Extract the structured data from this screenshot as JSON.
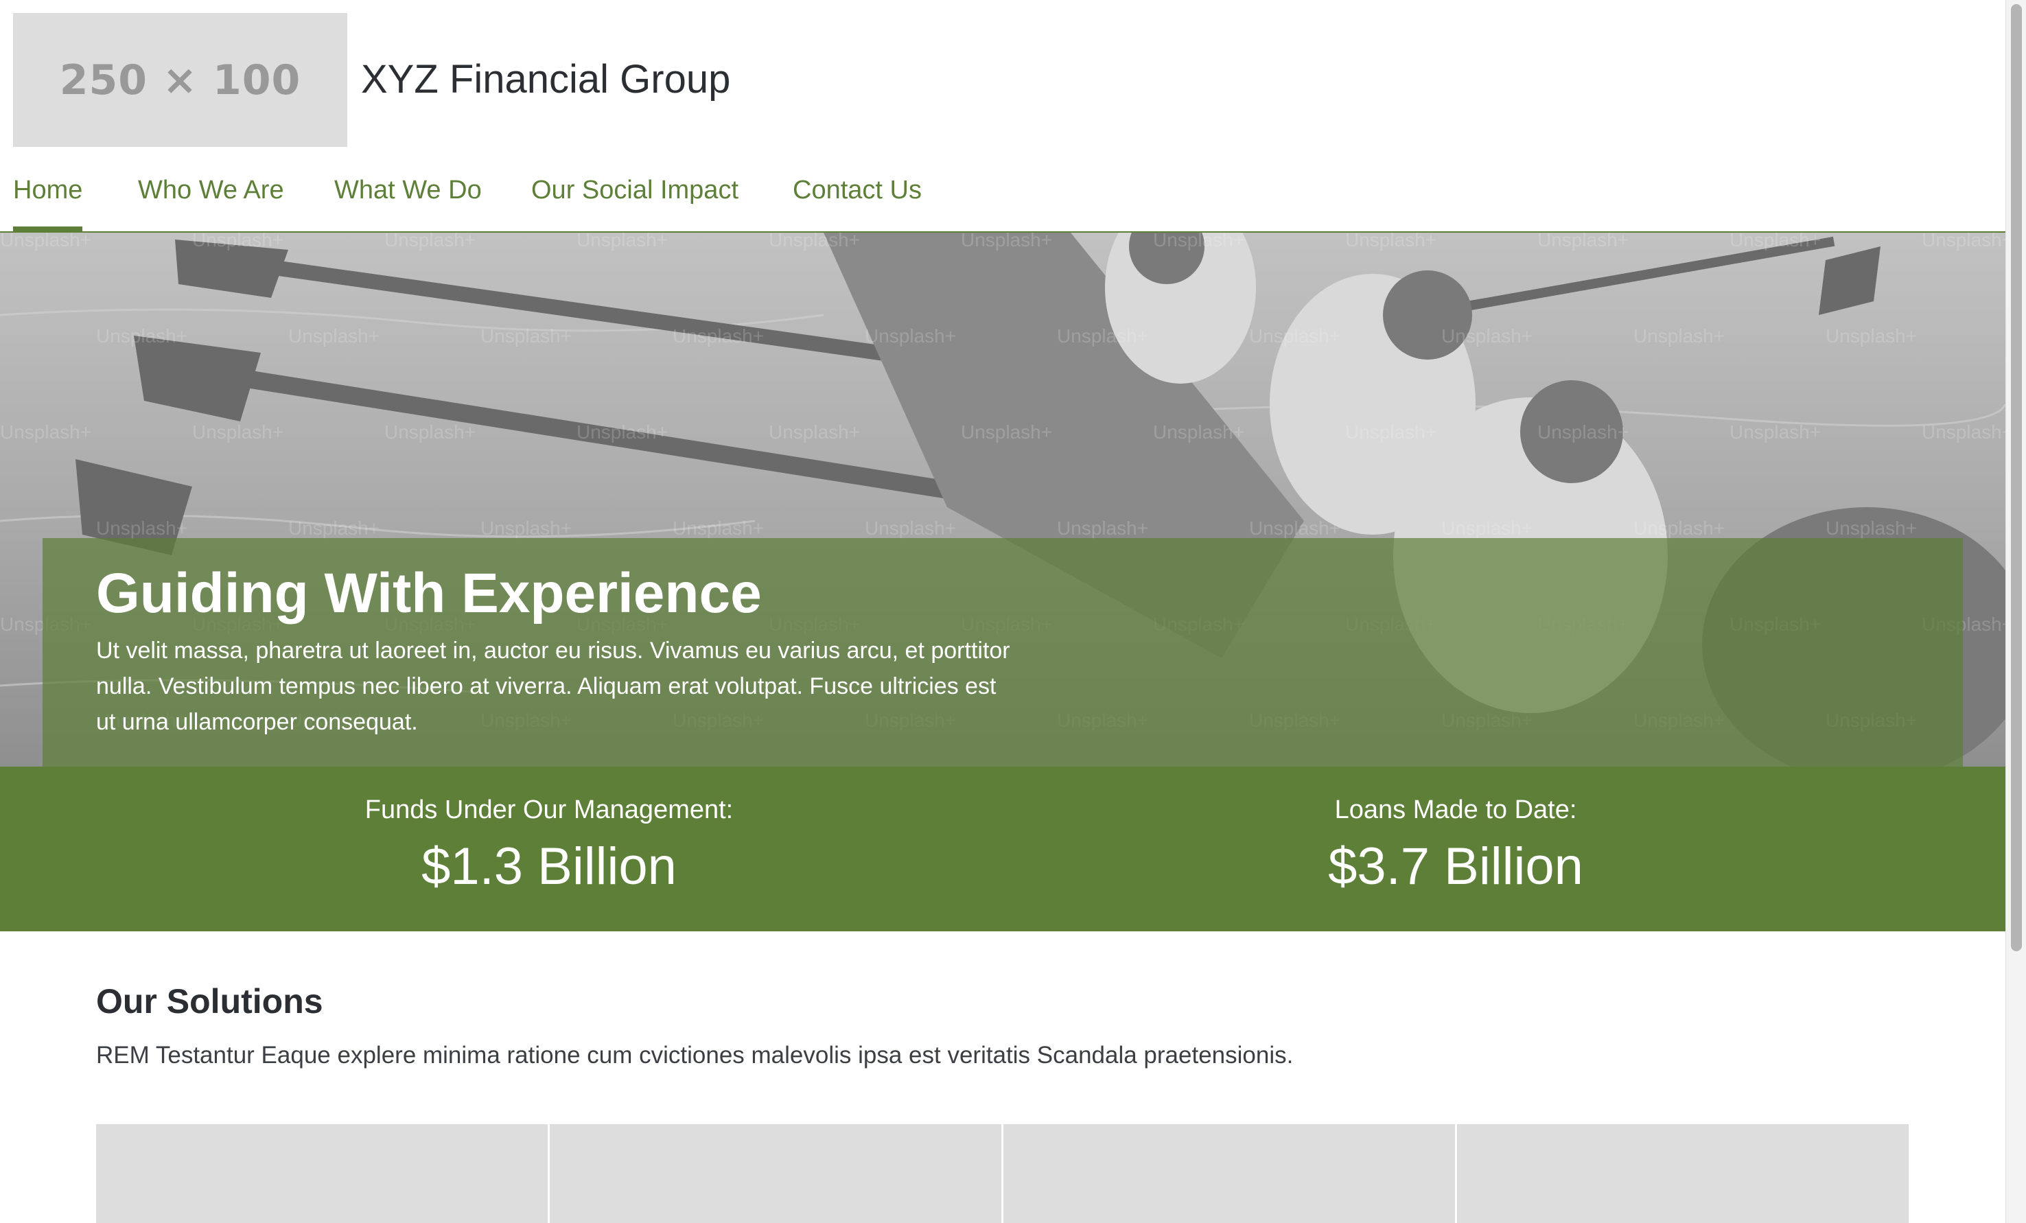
{
  "header": {
    "logo_placeholder": "250 × 100",
    "site_title": "XYZ Financial Group"
  },
  "nav": {
    "items": [
      {
        "label": "Home",
        "active": true
      },
      {
        "label": "Who We Are",
        "active": false
      },
      {
        "label": "What We Do",
        "active": false
      },
      {
        "label": "Our Social Impact",
        "active": false
      },
      {
        "label": "Contact Us",
        "active": false
      }
    ]
  },
  "hero": {
    "title": "Guiding With Experience",
    "text": "Ut velit massa, pharetra ut laoreet in, auctor eu risus. Vivamus eu varius arcu, et porttitor nulla. Vestibulum tempus nec libero at viverra. Aliquam erat volutpat. Fusce ultricies est ut urna ullamcorper consequat.",
    "watermark": "Unsplash+"
  },
  "stats": [
    {
      "label": "Funds Under Our Management:",
      "value": "$1.3 Billion"
    },
    {
      "label": "Loans Made to Date:",
      "value": "$3.7 Billion"
    }
  ],
  "solutions": {
    "heading": "Our Solutions",
    "description": "REM Testantur Eaque explere minima ratione cum cvictiones malevolis ipsa est veritatis Scandala praetensionis."
  },
  "colors": {
    "accent": "#5d7f37",
    "text": "#2b2f33",
    "placeholder": "#dddddd"
  }
}
